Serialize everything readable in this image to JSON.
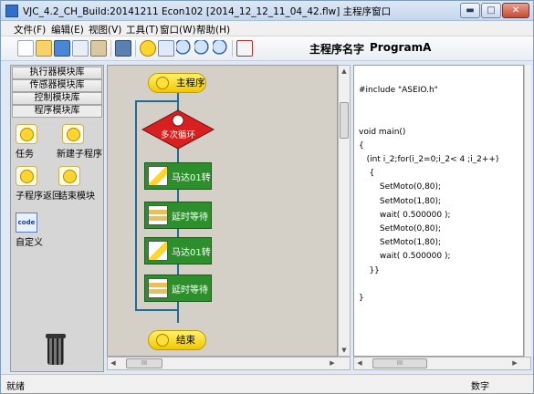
{
  "window": {
    "title": "VJC_4.2_CH_Build:20141211   Econ102        [2014_12_12_11_04_42.flw]        主程序窗口",
    "min_symbol": "▬",
    "max_symbol": "□",
    "close_symbol": "✕"
  },
  "menu": {
    "items": [
      "文件(F)",
      "编辑(E)",
      "视图(V)",
      "工具(T)",
      "窗口(W)",
      "帮助(H)"
    ]
  },
  "toolbar": {
    "program_name_label": "主程序名字",
    "program_name_value": "ProgramA",
    "icons": [
      "new-file-icon",
      "open-folder-icon",
      "save-icon",
      "copy-icon",
      "paste-icon",
      "run-icon",
      "smiley-icon",
      "view-icon",
      "zoom-in-icon",
      "zoom-out-icon",
      "zoom-reset-icon",
      "download-icon"
    ]
  },
  "left_panel": {
    "tabs": [
      "执行器模块库",
      "传感器模块库",
      "控制模块库",
      "程序模块库"
    ],
    "active_tab_index": 3,
    "modules": [
      {
        "label": "任务",
        "icon": "task-icon"
      },
      {
        "label": "新建子程序",
        "icon": "new-subroutine-icon"
      },
      {
        "label": "子程序返回",
        "icon": "subroutine-return-icon"
      },
      {
        "label": "结束模块",
        "icon": "end-module-icon"
      },
      {
        "label": "自定义",
        "icon": "custom-code-icon",
        "icon_text": "code"
      }
    ]
  },
  "flow": {
    "start_label": "主程序",
    "loop_label": "多次循环",
    "blocks": [
      {
        "label": "马达01转",
        "icon": "motor-icon"
      },
      {
        "label": "延时等待",
        "icon": "hourglass-icon"
      },
      {
        "label": "马达01转",
        "icon": "motor-icon"
      },
      {
        "label": "延时等待",
        "icon": "hourglass-icon"
      }
    ],
    "end_label": "结束"
  },
  "scrollbar": {
    "thumb_grip": "III"
  },
  "code": {
    "lines": [
      "#include \"ASEIO.h\"",
      "",
      "",
      "void main()",
      "{",
      "   (int i_2;for(i_2=0;i_2< 4 ;i_2++)",
      "    {",
      "        SetMoto(0,80);",
      "        SetMoto(1,80);",
      "        wait( 0.500000 );",
      "        SetMoto(0,80);",
      "        SetMoto(1,80);",
      "        wait( 0.500000 );",
      "    }}",
      "",
      "}"
    ]
  },
  "status": {
    "left": "就绪",
    "right": "数字"
  },
  "colors": {
    "flow_block": "#2c8f2c",
    "loop_diamond": "#d92020",
    "pill": "#f2c700",
    "canvas": "#d4d0c8"
  }
}
